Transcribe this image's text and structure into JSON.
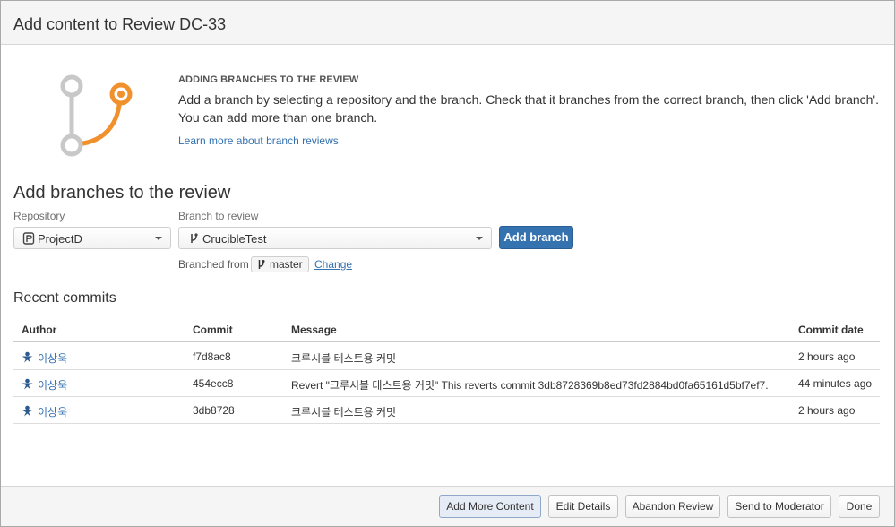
{
  "dialog": {
    "title": "Add content to Review DC-33"
  },
  "intro": {
    "heading": "ADDING BRANCHES TO THE REVIEW",
    "text": "Add a branch by selecting a repository and the branch. Check that it branches from the correct branch, then click 'Add branch'. You can add more than one branch.",
    "link": "Learn more about branch reviews",
    "graphic_colors": {
      "inactive": "#c8c8c8",
      "active": "#f0912e"
    }
  },
  "add_branches": {
    "title": "Add branches to the review",
    "repository_label": "Repository",
    "repository_value": "ProjectD",
    "branch_label": "Branch to review",
    "branch_value": "CrucibleTest",
    "add_button": "Add branch",
    "branched_from_label": "Branched from",
    "branched_from_value": "master",
    "change_link": "Change"
  },
  "recent_commits": {
    "title": "Recent commits",
    "columns": {
      "author": "Author",
      "commit": "Commit",
      "message": "Message",
      "date": "Commit date"
    },
    "rows": [
      {
        "author": "이상욱",
        "commit": "f7d8ac8",
        "message": "크루시블 테스트용 커밋",
        "date": "2 hours ago"
      },
      {
        "author": "이상욱",
        "commit": "454ecc8",
        "message": "Revert \"크루시블 테스트용 커밋\" This reverts commit 3db8728369b8ed73fd2884bd0fa65161d5bf7ef7.",
        "date": "44 minutes ago"
      },
      {
        "author": "이상욱",
        "commit": "3db8728",
        "message": "크루시블 테스트용 커밋",
        "date": "2 hours ago"
      }
    ]
  },
  "footer": {
    "add_more": "Add More Content",
    "edit_details": "Edit Details",
    "abandon": "Abandon Review",
    "send_moderator": "Send to Moderator",
    "done": "Done"
  },
  "colors": {
    "accent": "#3572b0",
    "link": "#3572b0"
  }
}
